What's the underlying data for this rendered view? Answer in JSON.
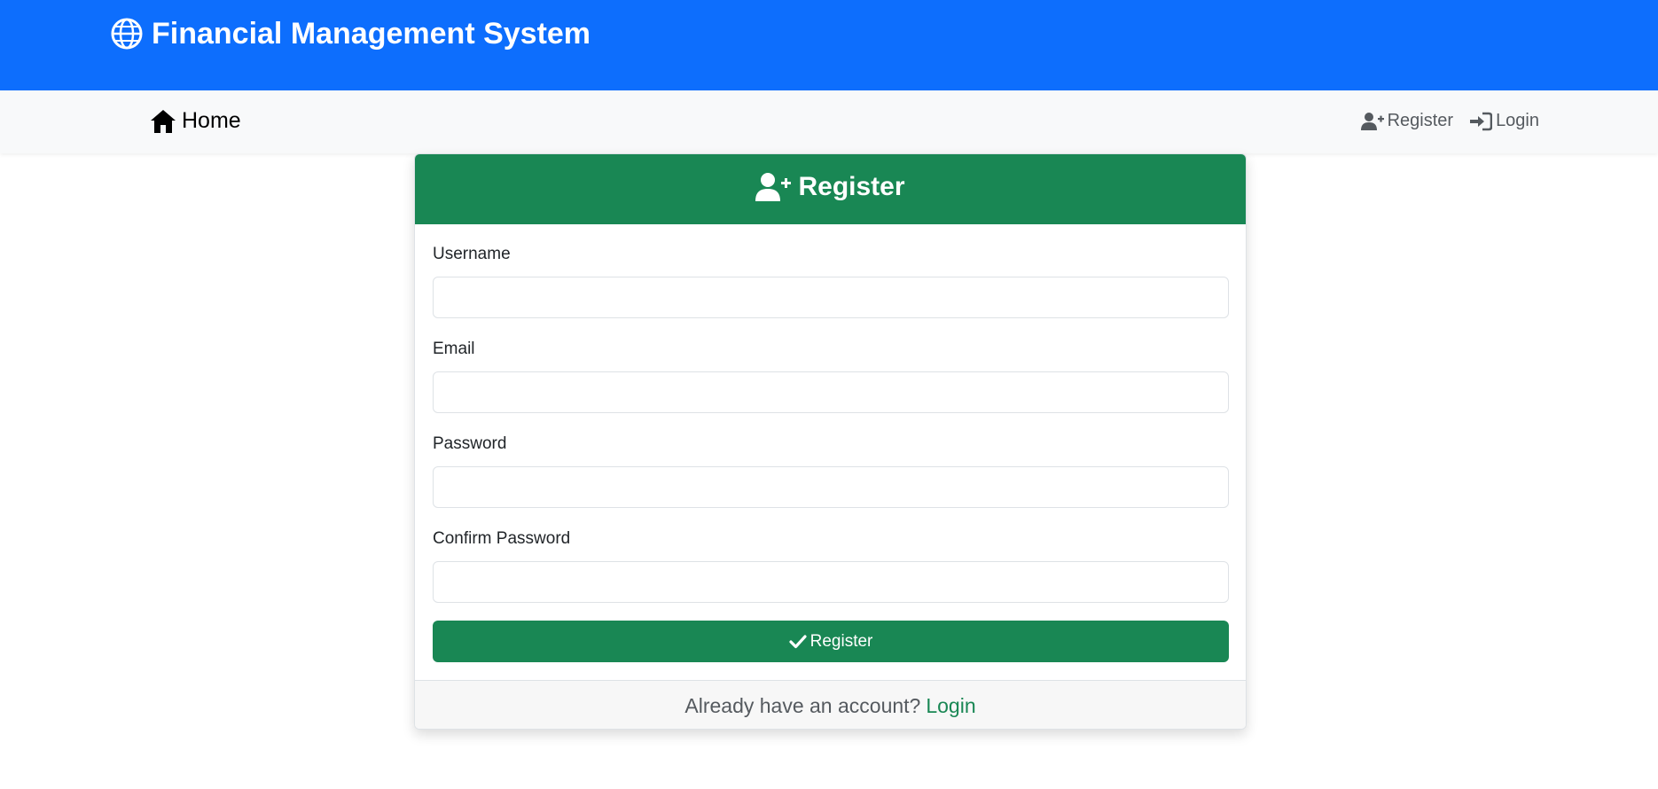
{
  "banner": {
    "title": "Financial Management System",
    "icon": "globe-icon",
    "color": "#0d6efd"
  },
  "navbar": {
    "home_label": "Home",
    "home_icon": "house-icon",
    "register_label": "Register",
    "register_icon": "user-plus-icon",
    "login_label": "Login",
    "login_icon": "sign-in-icon"
  },
  "card": {
    "header_title": "Register",
    "header_icon": "user-plus-icon",
    "accent_color": "#198754",
    "fields": [
      {
        "label": "Username",
        "value": ""
      },
      {
        "label": "Email",
        "value": ""
      },
      {
        "label": "Password",
        "value": ""
      },
      {
        "label": "Confirm Password",
        "value": ""
      }
    ],
    "submit_label": "Register",
    "submit_icon": "check-icon",
    "footer_text": "Already have an account?",
    "footer_link": "Login"
  }
}
